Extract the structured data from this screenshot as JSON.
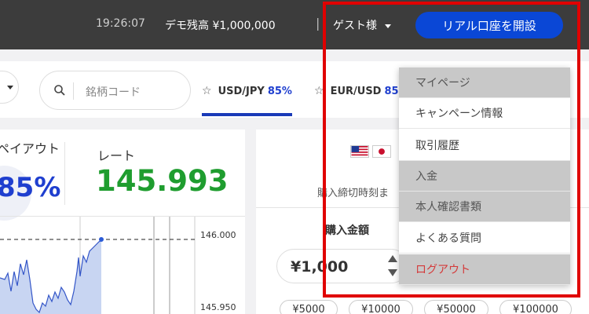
{
  "header": {
    "time": "19:26:07",
    "balance": "デモ残高 ¥1,000,000",
    "separator": "|",
    "guest": "ゲスト様",
    "open_account": "リアル口座を開設"
  },
  "symbols": {
    "search_placeholder": "銘柄コード",
    "tabs": [
      {
        "star": "☆",
        "pair": "USD/JPY",
        "payout": "85%"
      },
      {
        "star": "☆",
        "pair": "EUR/USD",
        "payout": "85"
      }
    ]
  },
  "quote": {
    "payout_label": "ペイアウト",
    "payout_value": "85%",
    "rate_label": "レート",
    "rate_value": "145.993"
  },
  "chart": {
    "ticks": [
      "146.000",
      "145.950"
    ]
  },
  "order": {
    "deadline": "購入締切時刻ま",
    "amount_label": "購入金額",
    "amount_value": "¥1,000",
    "presets": [
      "¥5000",
      "¥10000",
      "¥50000",
      "¥100000"
    ]
  },
  "menu": {
    "items": [
      "マイページ",
      "キャンペーン情報",
      "取引履歴",
      "入金",
      "本人確認書類",
      "よくある質問",
      "ログアウト"
    ]
  },
  "colors": {
    "topbar": "#3c3c3c",
    "accent_blue": "#0a47d6",
    "payout_blue": "#1f3fcf",
    "rate_green": "#1f9d2f",
    "logout_red": "#d43a3a",
    "highlight_red": "#e00000"
  }
}
